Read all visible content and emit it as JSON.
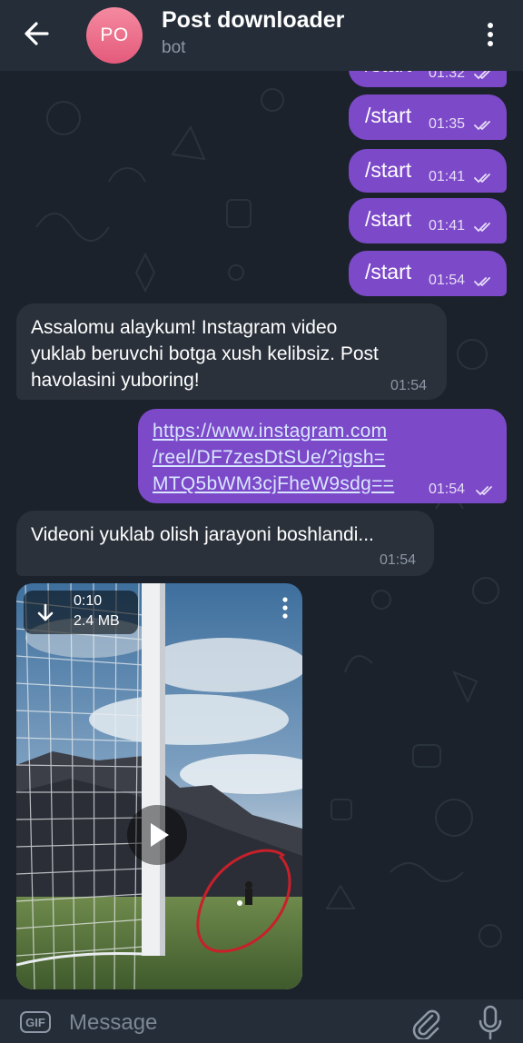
{
  "header": {
    "avatar_initials": "PO",
    "title": "Post downloader",
    "subtitle": "bot"
  },
  "messages": [
    {
      "type": "outgoing",
      "text": "/start",
      "time": "01:32",
      "status": "read"
    },
    {
      "type": "outgoing",
      "text": "/start",
      "time": "01:35",
      "status": "read"
    },
    {
      "type": "outgoing",
      "text": "/start",
      "time": "01:41",
      "status": "read"
    },
    {
      "type": "outgoing",
      "text": "/start",
      "time": "01:41",
      "status": "read"
    },
    {
      "type": "outgoing",
      "text": "/start",
      "time": "01:54",
      "status": "read"
    },
    {
      "type": "incoming",
      "lines": [
        "Assalomu alaykum! Instagram video",
        "yuklab beruvchi botga xush kelibsiz. Post",
        "havolasini yuboring!"
      ],
      "time": "01:54"
    },
    {
      "type": "outgoing",
      "lines": [
        "https://www.instagram.com",
        "/reel/DF7zesDtSUe/?igsh=",
        "MTQ5bWM3cjFheW9sdg=="
      ],
      "time": "01:54",
      "status": "read"
    },
    {
      "type": "incoming",
      "text": "Videoni yuklab olish jarayoni boshlandi...",
      "time": "01:54"
    },
    {
      "type": "incoming-video",
      "duration": "0:10",
      "size": "2.4 MB"
    }
  ],
  "input": {
    "gif_label": "GIF",
    "placeholder": "Message"
  },
  "colors": {
    "header_bg": "#242d38",
    "chat_bg": "#1b222b",
    "outgoing_bubble": "#7c49c9",
    "incoming_bubble": "#2a313b",
    "avatar": "#e45a7b",
    "secondary_text": "#8d97a5"
  },
  "icons": {
    "back": "arrow-left-icon",
    "menu": "more-vertical-icon",
    "read_status": "double-check-icon",
    "download": "download-arrow-icon",
    "play": "play-icon",
    "gif": "gif-icon",
    "attach": "paperclip-icon",
    "mic": "microphone-icon"
  }
}
